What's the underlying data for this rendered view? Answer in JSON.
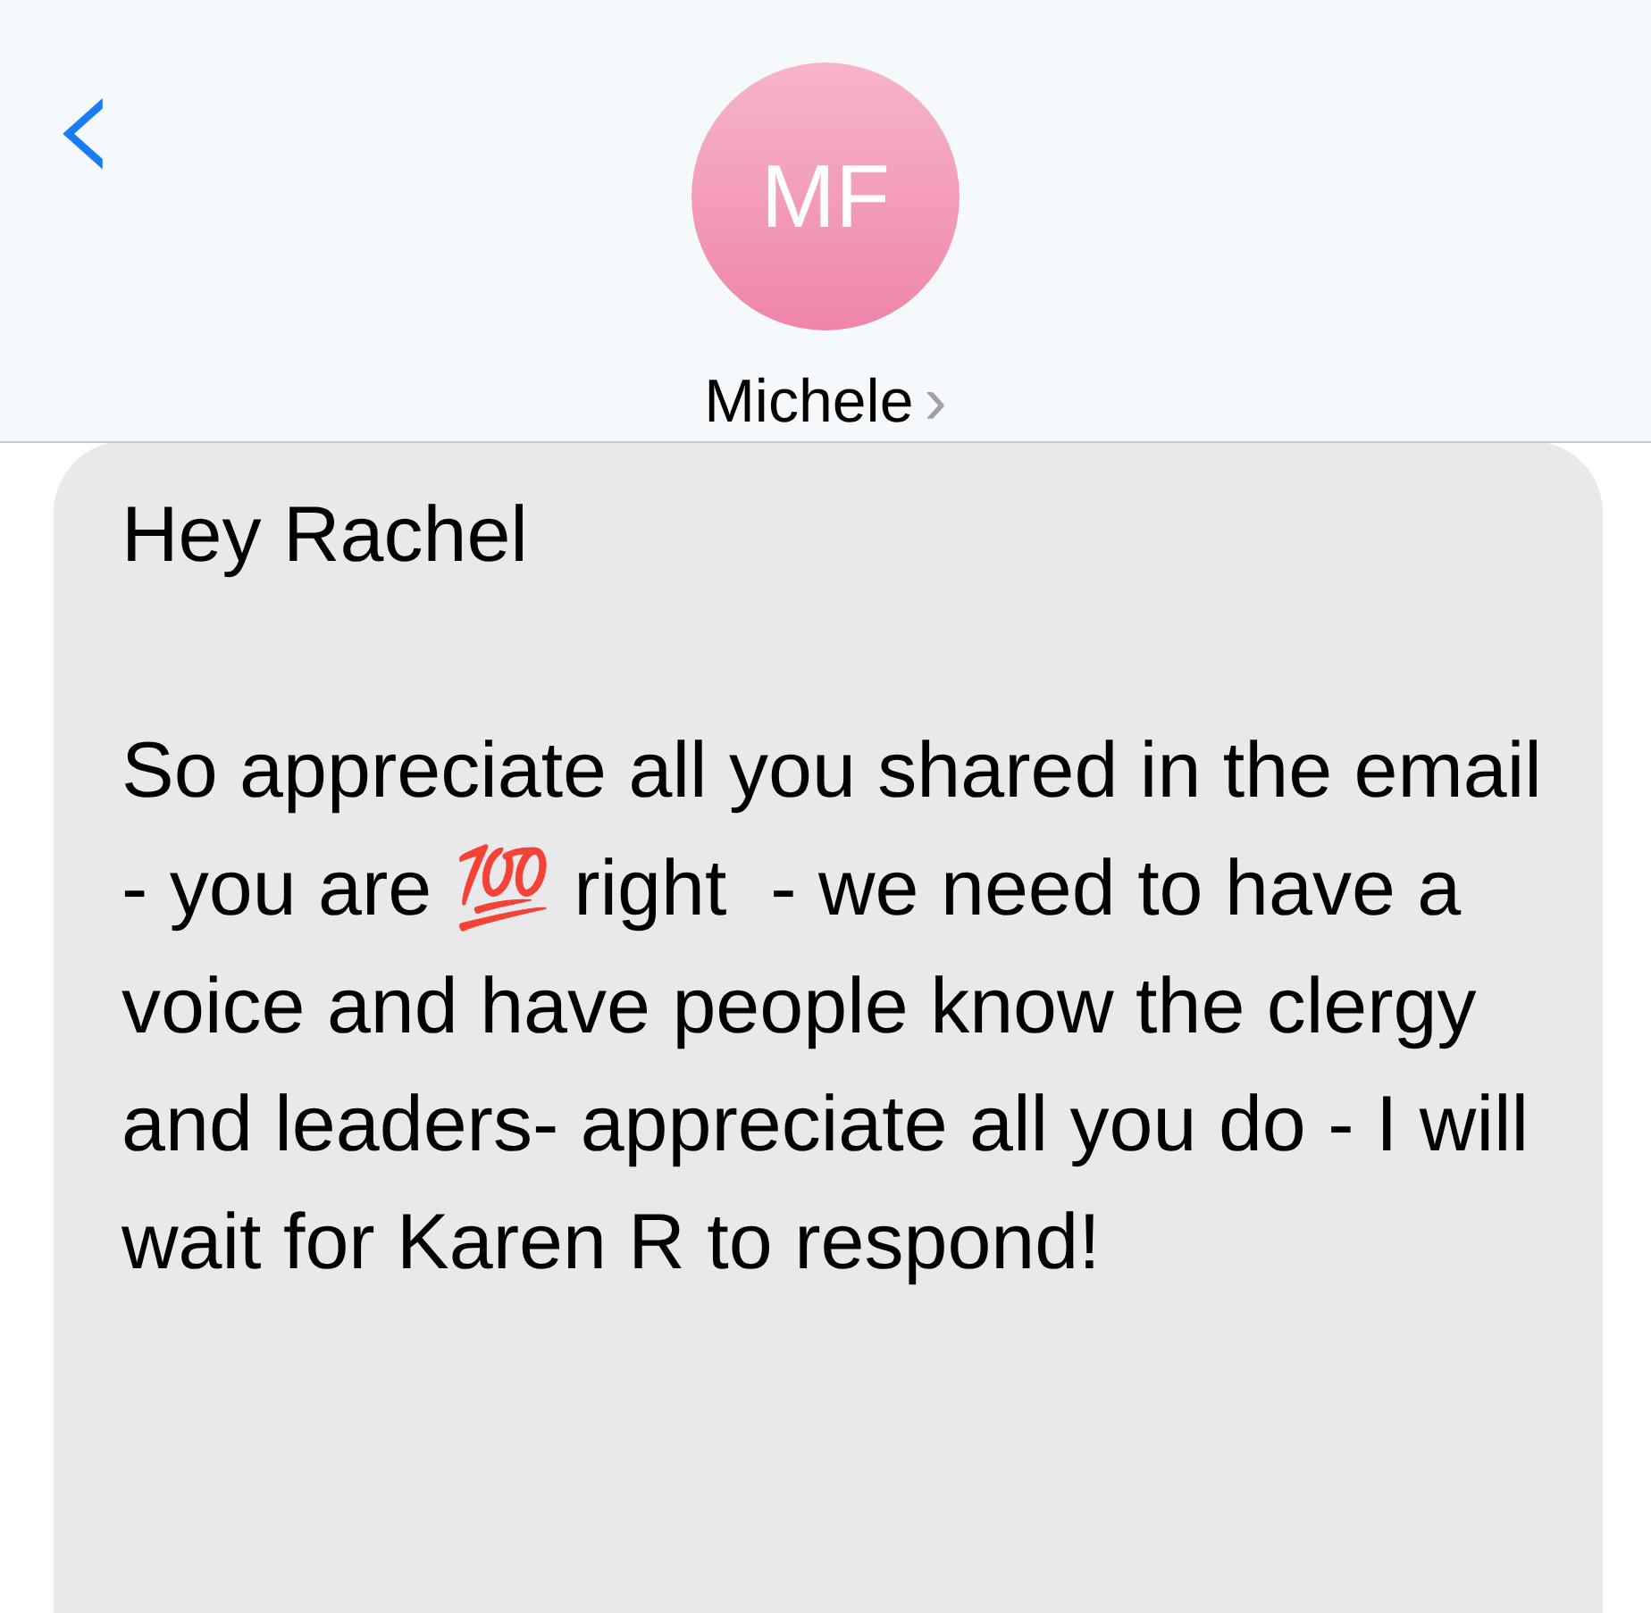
{
  "header": {
    "back": "‹",
    "avatar_initials": "MF",
    "contact_name": "Michele",
    "contact_chevron": "›"
  },
  "message": {
    "paragraphs": [
      "Hey Rachel",
      "So appreciate all you shared in the email - you are 💯 right  - we need to have a voice and have people know the clergy and leaders- appreciate all you do - I will wait for Karen R to respond!"
    ]
  }
}
